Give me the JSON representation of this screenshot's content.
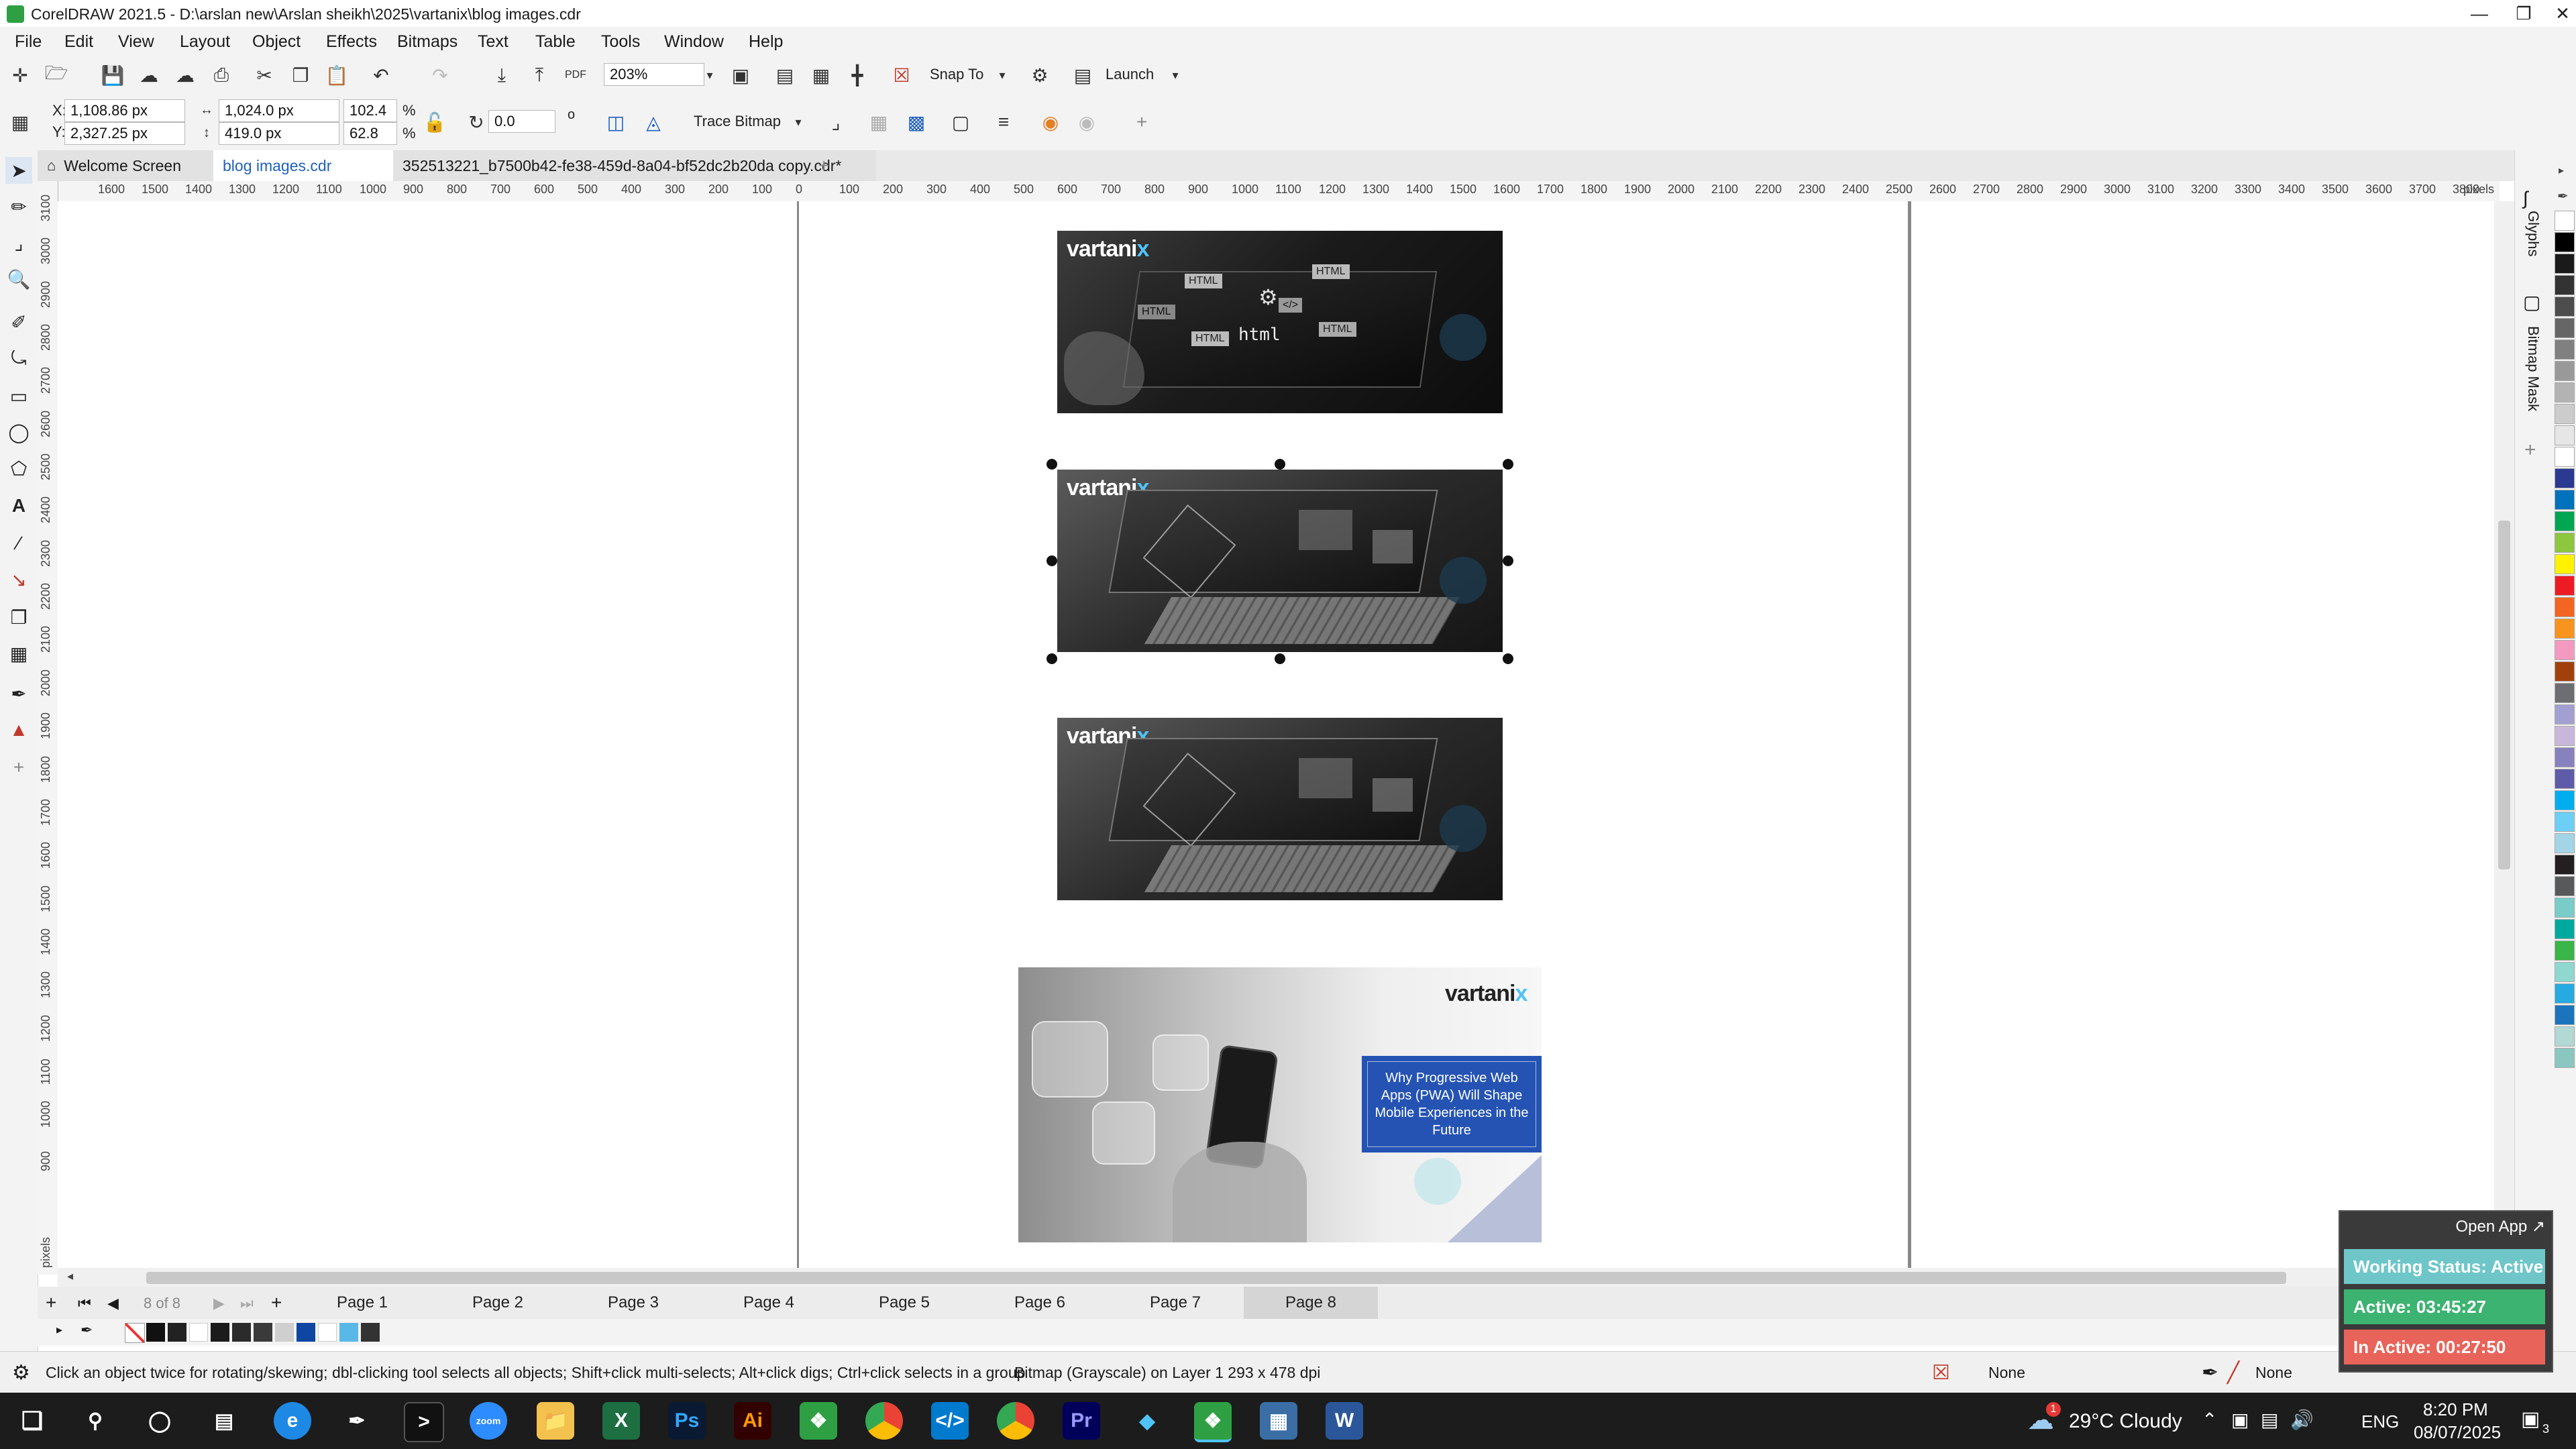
{
  "window": {
    "title": "CorelDRAW 2021.5 - D:\\arslan new\\Arslan sheikh\\2025\\vartanix\\blog images.cdr"
  },
  "menu": [
    "File",
    "Edit",
    "View",
    "Layout",
    "Object",
    "Effects",
    "Bitmaps",
    "Text",
    "Table",
    "Tools",
    "Window",
    "Help"
  ],
  "toolbar1": {
    "zoom": "203%",
    "snap_to": "Snap To",
    "launch": "Launch",
    "pdf": "PDF"
  },
  "toolbar2": {
    "x_label": "X:",
    "x": "1,108.86 px",
    "y_label": "Y:",
    "y": "2,327.25 px",
    "width": "1,024.0 px",
    "height": "419.0 px",
    "scale_x": "102.4",
    "scale_y": "62.8",
    "percent": "%",
    "rotation": "0.0",
    "degree": "o",
    "trace_bitmap": "Trace Bitmap"
  },
  "tabs": [
    {
      "label": "Welcome Screen"
    },
    {
      "label": "blog images.cdr"
    },
    {
      "label": "352513221_b7500b42-fe38-459d-8a04-bf52dc2b20da copy.cdr*"
    }
  ],
  "ruler": {
    "top_ticks": [
      "1600",
      "1500",
      "1400",
      "1300",
      "1200",
      "1100",
      "1000",
      "900",
      "800",
      "700",
      "600",
      "500",
      "400",
      "300",
      "200",
      "100",
      "0",
      "100",
      "200",
      "300",
      "400",
      "500",
      "600",
      "700",
      "800",
      "900",
      "1000",
      "1100",
      "1200",
      "1300",
      "1400",
      "1500",
      "1600",
      "1700",
      "1800",
      "1900",
      "2000",
      "2100",
      "2200",
      "2300",
      "2400",
      "2500",
      "2600",
      "2700",
      "2800",
      "2900",
      "3000",
      "3100",
      "3200",
      "3300",
      "3400",
      "3500",
      "3600",
      "3700",
      "3800"
    ],
    "unit": "pixels",
    "left_ticks": [
      "3100",
      "3000",
      "2900",
      "2800",
      "2700",
      "2600",
      "2500",
      "2400",
      "2300",
      "2200",
      "2100",
      "2000",
      "1900",
      "1800",
      "1700",
      "1600",
      "1500",
      "1400",
      "1300",
      "1200",
      "1100",
      "1000",
      "900"
    ],
    "left_unit": "pixels"
  },
  "canvas": {
    "brand": "vartani",
    "brand_x": "x",
    "img1_labels": [
      "HTML",
      "HTML",
      "HTML",
      "</>",
      "HTML",
      "html",
      "HTML"
    ],
    "promo_text": "Why Progressive Web Apps (PWA) Will Shape Mobile Experiences in the Future"
  },
  "dockers": [
    "Glyphs",
    "Bitmap Mask"
  ],
  "pages": {
    "counter": "8 of 8",
    "tabs": [
      "Page 1",
      "Page 2",
      "Page 3",
      "Page 4",
      "Page 5",
      "Page 6",
      "Page 7",
      "Page 8"
    ],
    "active_index": 7
  },
  "status": {
    "hint": "Click an object twice for rotating/skewing; dbl-clicking tool selects all objects; Shift+click multi-selects; Alt+click digs; Ctrl+click selects in a group",
    "object_info": "Bitmap (Grayscale) on Layer 1 293 x 478 dpi",
    "fill": "None",
    "outline": "None"
  },
  "widget": {
    "open_app": "Open App ↗",
    "working_status": "Working Status: Active",
    "active": "Active: 03:45:27",
    "inactive": "In Active: 00:27:50"
  },
  "taskbar": {
    "weather": "29°C  Cloudy",
    "lang": "ENG",
    "time": "8:20 PM",
    "date": "08/07/2025",
    "notif_count": "3",
    "weather_badge": "1"
  },
  "colors": {
    "accent_blue": "#1f5fbf",
    "selection": "#111111",
    "working": "#6ec6c8",
    "active": "#3cb371",
    "inactive": "#e8645a",
    "promo_box": "#2453b3"
  },
  "palette_colors": [
    "#ffffff",
    "#000000",
    "#1a1a1a",
    "#333333",
    "#4d4d4d",
    "#666666",
    "#808080",
    "#999999",
    "#b3b3b3",
    "#cccccc",
    "#e6e6e6",
    "#ffffff",
    "#2b3990",
    "#0072bc",
    "#00a651",
    "#8dc63f",
    "#fff200",
    "#ed1c24",
    "#f26522",
    "#f7941d",
    "#f49ac1",
    "#a0410d",
    "#6d6e71",
    "#a3a0d1",
    "#c7b8db",
    "#8781bd",
    "#5e5ca8",
    "#00aeef",
    "#6dcff6",
    "#a3d5e6",
    "#231f20",
    "#58595b",
    "#7accc8",
    "#00a99d",
    "#39b54a",
    "#8ed8d0",
    "#27aae1",
    "#1c75bc",
    "#b2d9d4",
    "#8ac7c0"
  ]
}
